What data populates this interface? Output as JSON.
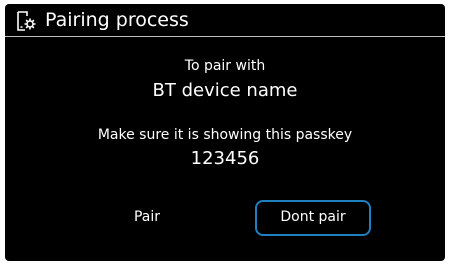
{
  "header": {
    "title": "Pairing process",
    "icon": "phone-gear-icon"
  },
  "message": {
    "pair_with": "To pair with",
    "device_name": "BT device name",
    "passkey_note": "Make sure it is showing this passkey",
    "passkey": "123456"
  },
  "actions": {
    "pair_label": "Pair",
    "dont_pair_label": "Dont pair"
  },
  "colors": {
    "background": "#000000",
    "text": "#ffffff",
    "focus_border": "#1f7fbf",
    "divider": "#bfbfbf"
  }
}
